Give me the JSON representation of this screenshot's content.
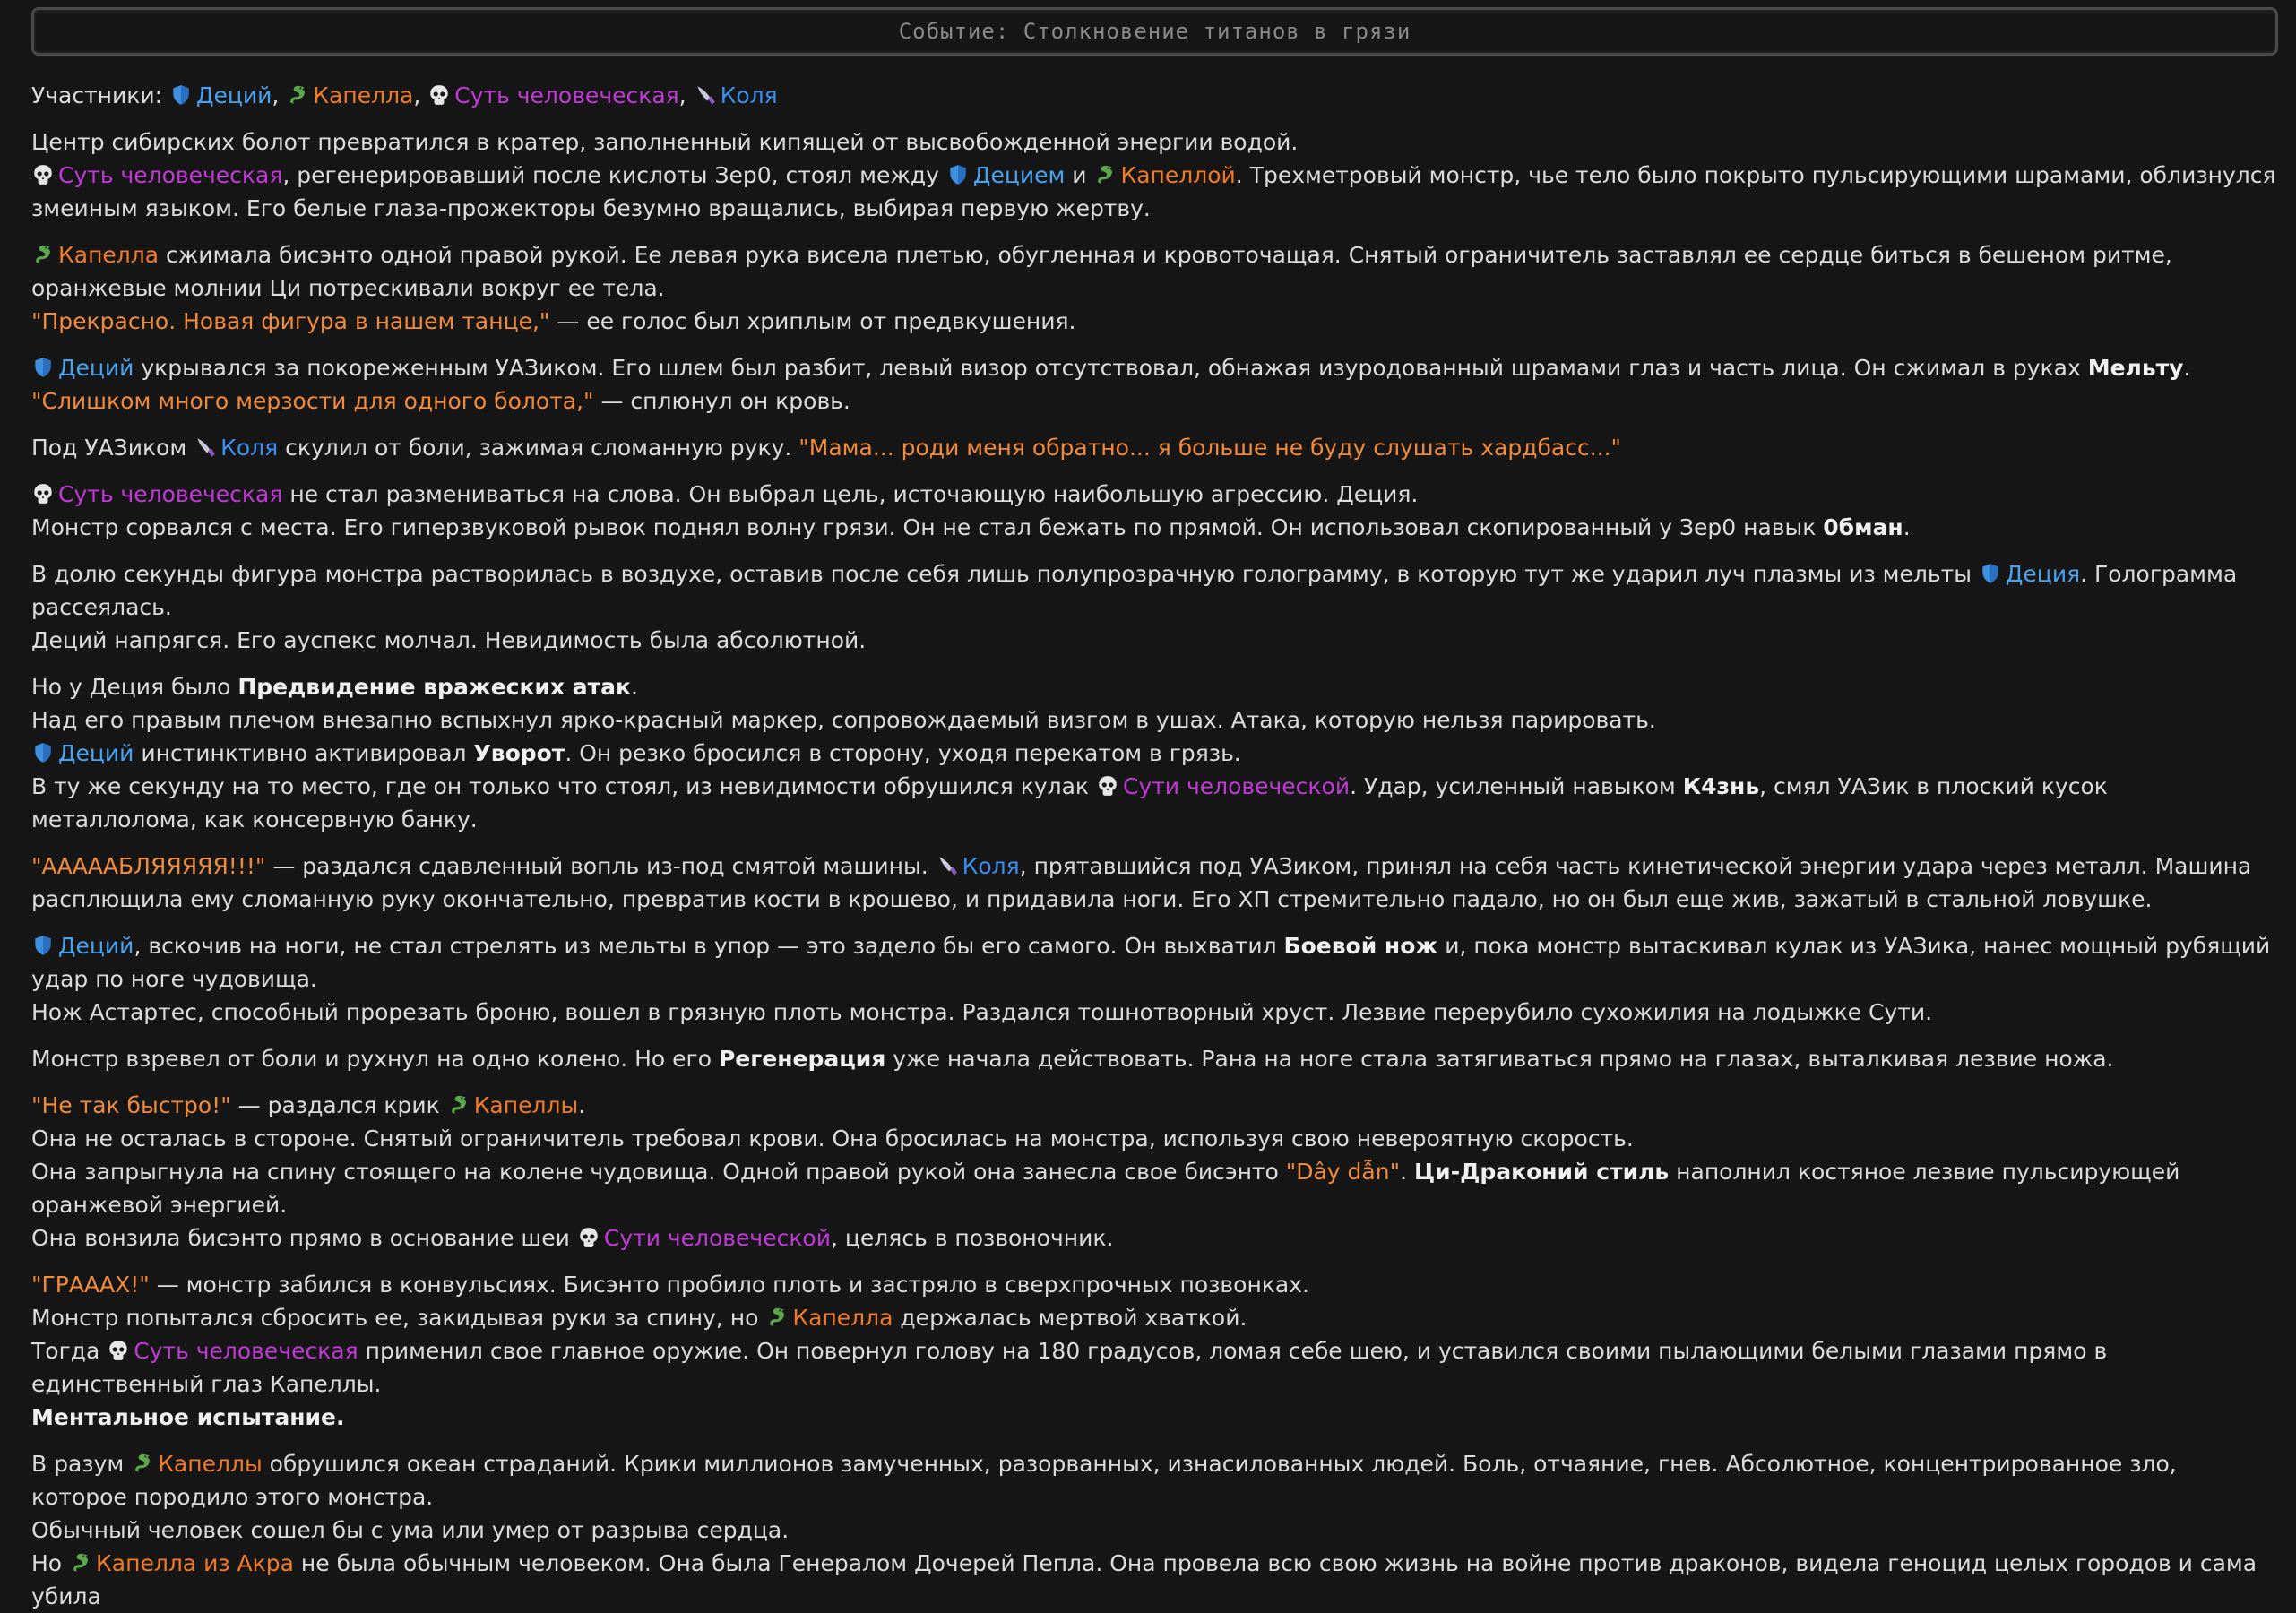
{
  "event_title": "Событие: Столкновение титанов в грязи",
  "participants_label": "Участники:",
  "names": {
    "decius": "Деций",
    "decius_dat": "Децием",
    "decius_gen": "Деция",
    "kapella": "Капелла",
    "kapella_ins": "Капеллой",
    "kapella_gen": "Капеллы",
    "kapella_akr": "Капелла из Акра",
    "sut": "Суть человеческая",
    "sut_gen": "Сути человеческой",
    "sut_dat": "Сути человеческой",
    "kolya": "Коля"
  },
  "icons": {
    "decius": "shield-icon",
    "kapella": "dragon-icon",
    "sut": "skull-icon",
    "kolya": "knife-icon"
  },
  "colors": {
    "decius": "#4aa3f0",
    "kapella": "#f07a2a",
    "sut": "#c03ad6",
    "kolya": "#3a8ff0",
    "quote": "#f08a3c"
  },
  "text": {
    "p1l1": "Центр сибирских болот превратился в кратер, заполненный кипящей от высвобожденной энергии водой.",
    "p1l2a": ", регенерировавший после кислоты Зер0, стоял между ",
    "p1l2b": " и ",
    "p1l2c": ". Трехметровый монстр, чье тело было покрыто пульсирующими шрамами, облизнулся змеиным языком. Его белые глаза-прожекторы безумно вращались, выбирая первую жертву.",
    "p2l1": " сжимала бисэнто одной правой рукой. Ее левая рука висела плетью, обугленная и кровоточащая. Снятый ограничитель заставлял ее сердце биться в бешеном ритме, оранжевые молнии Ци потрескивали вокруг ее тела.",
    "p2q": "\"Прекрасно. Новая фигура в нашем танце,\"",
    "p2l2": " — ее голос был хриплым от предвкушения.",
    "p3l1": " укрывался за покореженным УАЗиком. Его шлем был разбит, левый визор отсутствовал, обнажая изуродованный шрамами глаз и часть лица. Он сжимал в руках ",
    "p3b": "Мельту",
    "p3q": "\"Слишком много мерзости для одного болота,\"",
    "p3l2": " — сплюнул он кровь.",
    "p4a": "Под УАЗиком ",
    "p4b": " скулил от боли, зажимая сломанную руку. ",
    "p4q": "\"Мама... роди меня обратно... я больше не буду слушать хардбасс...\"",
    "p5l1": " не стал размениваться на слова. Он выбрал цель, источающую наибольшую агрессию. Деция.",
    "p5l2": "Монстр сорвался с места. Его гиперзвуковой рывок поднял волну грязи. Он не стал бежать по прямой. Он использовал скопированный у Зер0 навык ",
    "p5b": "0бман",
    "p6l1": "В долю секунды фигура монстра растворилась в воздухе, оставив после себя лишь полупрозрачную голограмму, в которую тут же ударил луч плазмы из мельты ",
    "p6l1b": ". Голограмма рассеялась.",
    "p6l2": "Деций напрягся. Его ауспекс молчал. Невидимость была абсолютной.",
    "p7l1": "Но у Деция было ",
    "p7b1": "Предвидение вражеских атак",
    "p7l2": "Над его правым плечом внезапно вспыхнул ярко-красный маркер, сопровождаемый визгом в ушах. Атака, которую нельзя парировать.",
    "p7l3": " инстинктивно активировал ",
    "p7b2": "Уворот",
    "p7l3b": ". Он резко бросился в сторону, уходя перекатом в грязь.",
    "p7l4": "В ту же секунду на то место, где он только что стоял, из невидимости обрушился кулак ",
    "p7l4b": ". Удар, усиленный навыком ",
    "p7b3": "К4знь",
    "p7l4c": ", смял УАЗик в плоский кусок металлолома, как консервную банку.",
    "p8q": "\"АААААБЛЯЯЯЯЯ!!!\"",
    "p8a": " — раздался сдавленный вопль из-под смятой машины. ",
    "p8b": ", прятавшийся под УАЗиком, принял на себя часть кинетической энергии удара через металл. Машина расплющила ему сломанную руку окончательно, превратив кости в крошево, и придавила ноги. Его ХП стремительно падало, но он был еще жив, зажатый в стальной ловушке.",
    "p9a": ", вскочив на ноги, не стал стрелять из мельты в упор — это задело бы его самого. Он выхватил ",
    "p9b": "Боевой нож",
    "p9c": " и, пока монстр вытаскивал кулак из УАЗика, нанес мощный рубящий удар по ноге чудовища.",
    "p9l2": "Нож Астартес, способный прорезать броню, вошел в грязную плоть монстра. Раздался тошнотворный хруст. Лезвие перерубило сухожилия на лодыжке Сути.",
    "p10a": "Монстр взревел от боли и рухнул на одно колено. Но его ",
    "p10b": "Регенерация",
    "p10c": " уже начала действовать. Рана на ноге стала затягиваться прямо на глазах, выталкивая лезвие ножа.",
    "p11q": "\"Не так быстро!\"",
    "p11a": " — раздался крик ",
    "p11l2": "Она не осталась в стороне. Снятый ограничитель требовал крови. Она бросилась на монстра, используя свою невероятную скорость.",
    "p11l3": "Она запрыгнула на спину стоящего на колене чудовища. Одной правой рукой она занесла свое бисэнто ",
    "p11q2": "\"Dây dẫn\"",
    "p11b": "Ци-Драконий стиль",
    "p11l3b": " наполнил костяное лезвие пульсирующей оранжевой энергией.",
    "p11l4": "Она вонзила бисэнто прямо в основание шеи ",
    "p11l4b": ", целясь в позвоночник.",
    "p12q": "\"ГРАААХ!\"",
    "p12a": " — монстр забился в конвульсиях. Бисэнто пробило плоть и застряло в сверхпрочных позвонках.",
    "p12l2": "Монстр попытался сбросить ее, закидывая руки за спину, но ",
    "p12l2b": " держалась мертвой хваткой.",
    "p12l3": "Тогда ",
    "p12l3b": " применил свое главное оружие. Он повернул голову на 180 градусов, ломая себе шею, и уставился своими пылающими белыми глазами прямо в единственный глаз Капеллы.",
    "p12b": "Ментальное испытание.",
    "p13a": "В разум ",
    "p13b": " обрушился океан страданий. Крики миллионов замученных, разорванных, изнасилованных людей. Боль, отчаяние, гнев. Абсолютное, концентрированное зло, которое породило этого монстра.",
    "p13l2": "Обычный человек сошел бы с ума или умер от разрыва сердца.",
    "p13l3": "Но ",
    "p13l3b": " не была обычным человеком. Она была Генералом Дочерей Пепла. Она провела всю свою жизнь на войне против драконов, видела геноцид целых городов и сама убила"
  }
}
